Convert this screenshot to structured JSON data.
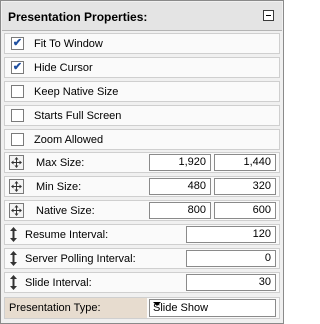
{
  "panel": {
    "title": "Presentation Properties:"
  },
  "checkboxes": [
    {
      "label": "Fit To Window",
      "checked": true
    },
    {
      "label": "Hide Cursor",
      "checked": true
    },
    {
      "label": "Keep Native Size",
      "checked": false
    },
    {
      "label": "Starts Full Screen",
      "checked": false
    },
    {
      "label": "Zoom Allowed",
      "checked": false
    }
  ],
  "sizes": {
    "max": {
      "label": "Max Size:",
      "w": "1,920",
      "h": "1,440"
    },
    "min": {
      "label": "Min Size:",
      "w": "480",
      "h": "320"
    },
    "native": {
      "label": "Native Size:",
      "w": "800",
      "h": "600"
    }
  },
  "intervals": {
    "resume": {
      "label": "Resume Interval:",
      "value": "120"
    },
    "polling": {
      "label": "Server Polling Interval:",
      "value": "0"
    },
    "slide": {
      "label": "Slide Interval:",
      "value": "30"
    }
  },
  "presentation_type": {
    "label": "Presentation Type:",
    "value": "Slide Show"
  },
  "icons": {
    "collapse": "minus-box-icon",
    "checkmark": "✔",
    "move": "four-way-arrow-icon",
    "vertical": "vertical-resize-icon",
    "dropdown": "chevron-down-icon"
  }
}
